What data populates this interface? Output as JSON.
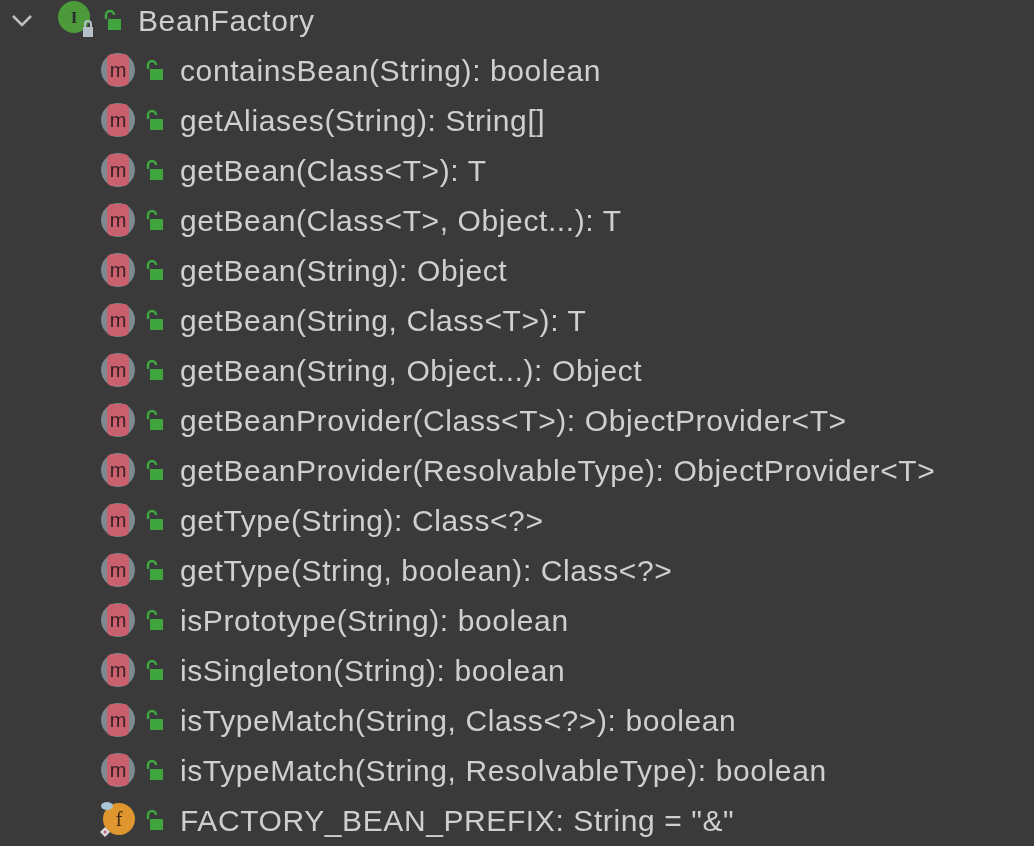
{
  "tree": {
    "label": "BeanFactory",
    "kind": "interface",
    "icon_letter": "I",
    "expanded": true,
    "children": [
      {
        "label": "containsBean(String): boolean",
        "kind": "method",
        "icon_letter": "m"
      },
      {
        "label": "getAliases(String): String[]",
        "kind": "method",
        "icon_letter": "m"
      },
      {
        "label": "getBean(Class<T>): T",
        "kind": "method",
        "icon_letter": "m"
      },
      {
        "label": "getBean(Class<T>, Object...): T",
        "kind": "method",
        "icon_letter": "m"
      },
      {
        "label": "getBean(String): Object",
        "kind": "method",
        "icon_letter": "m"
      },
      {
        "label": "getBean(String, Class<T>): T",
        "kind": "method",
        "icon_letter": "m"
      },
      {
        "label": "getBean(String, Object...): Object",
        "kind": "method",
        "icon_letter": "m"
      },
      {
        "label": "getBeanProvider(Class<T>): ObjectProvider<T>",
        "kind": "method",
        "icon_letter": "m"
      },
      {
        "label": "getBeanProvider(ResolvableType): ObjectProvider<T>",
        "kind": "method",
        "icon_letter": "m"
      },
      {
        "label": "getType(String): Class<?>",
        "kind": "method",
        "icon_letter": "m"
      },
      {
        "label": "getType(String, boolean): Class<?>",
        "kind": "method",
        "icon_letter": "m"
      },
      {
        "label": "isPrototype(String): boolean",
        "kind": "method",
        "icon_letter": "m"
      },
      {
        "label": "isSingleton(String): boolean",
        "kind": "method",
        "icon_letter": "m"
      },
      {
        "label": "isTypeMatch(String, Class<?>): boolean",
        "kind": "method",
        "icon_letter": "m"
      },
      {
        "label": "isTypeMatch(String, ResolvableType): boolean",
        "kind": "method",
        "icon_letter": "m"
      },
      {
        "label": "FACTORY_BEAN_PREFIX: String = \"&\"",
        "kind": "field",
        "icon_letter": "f"
      }
    ]
  }
}
